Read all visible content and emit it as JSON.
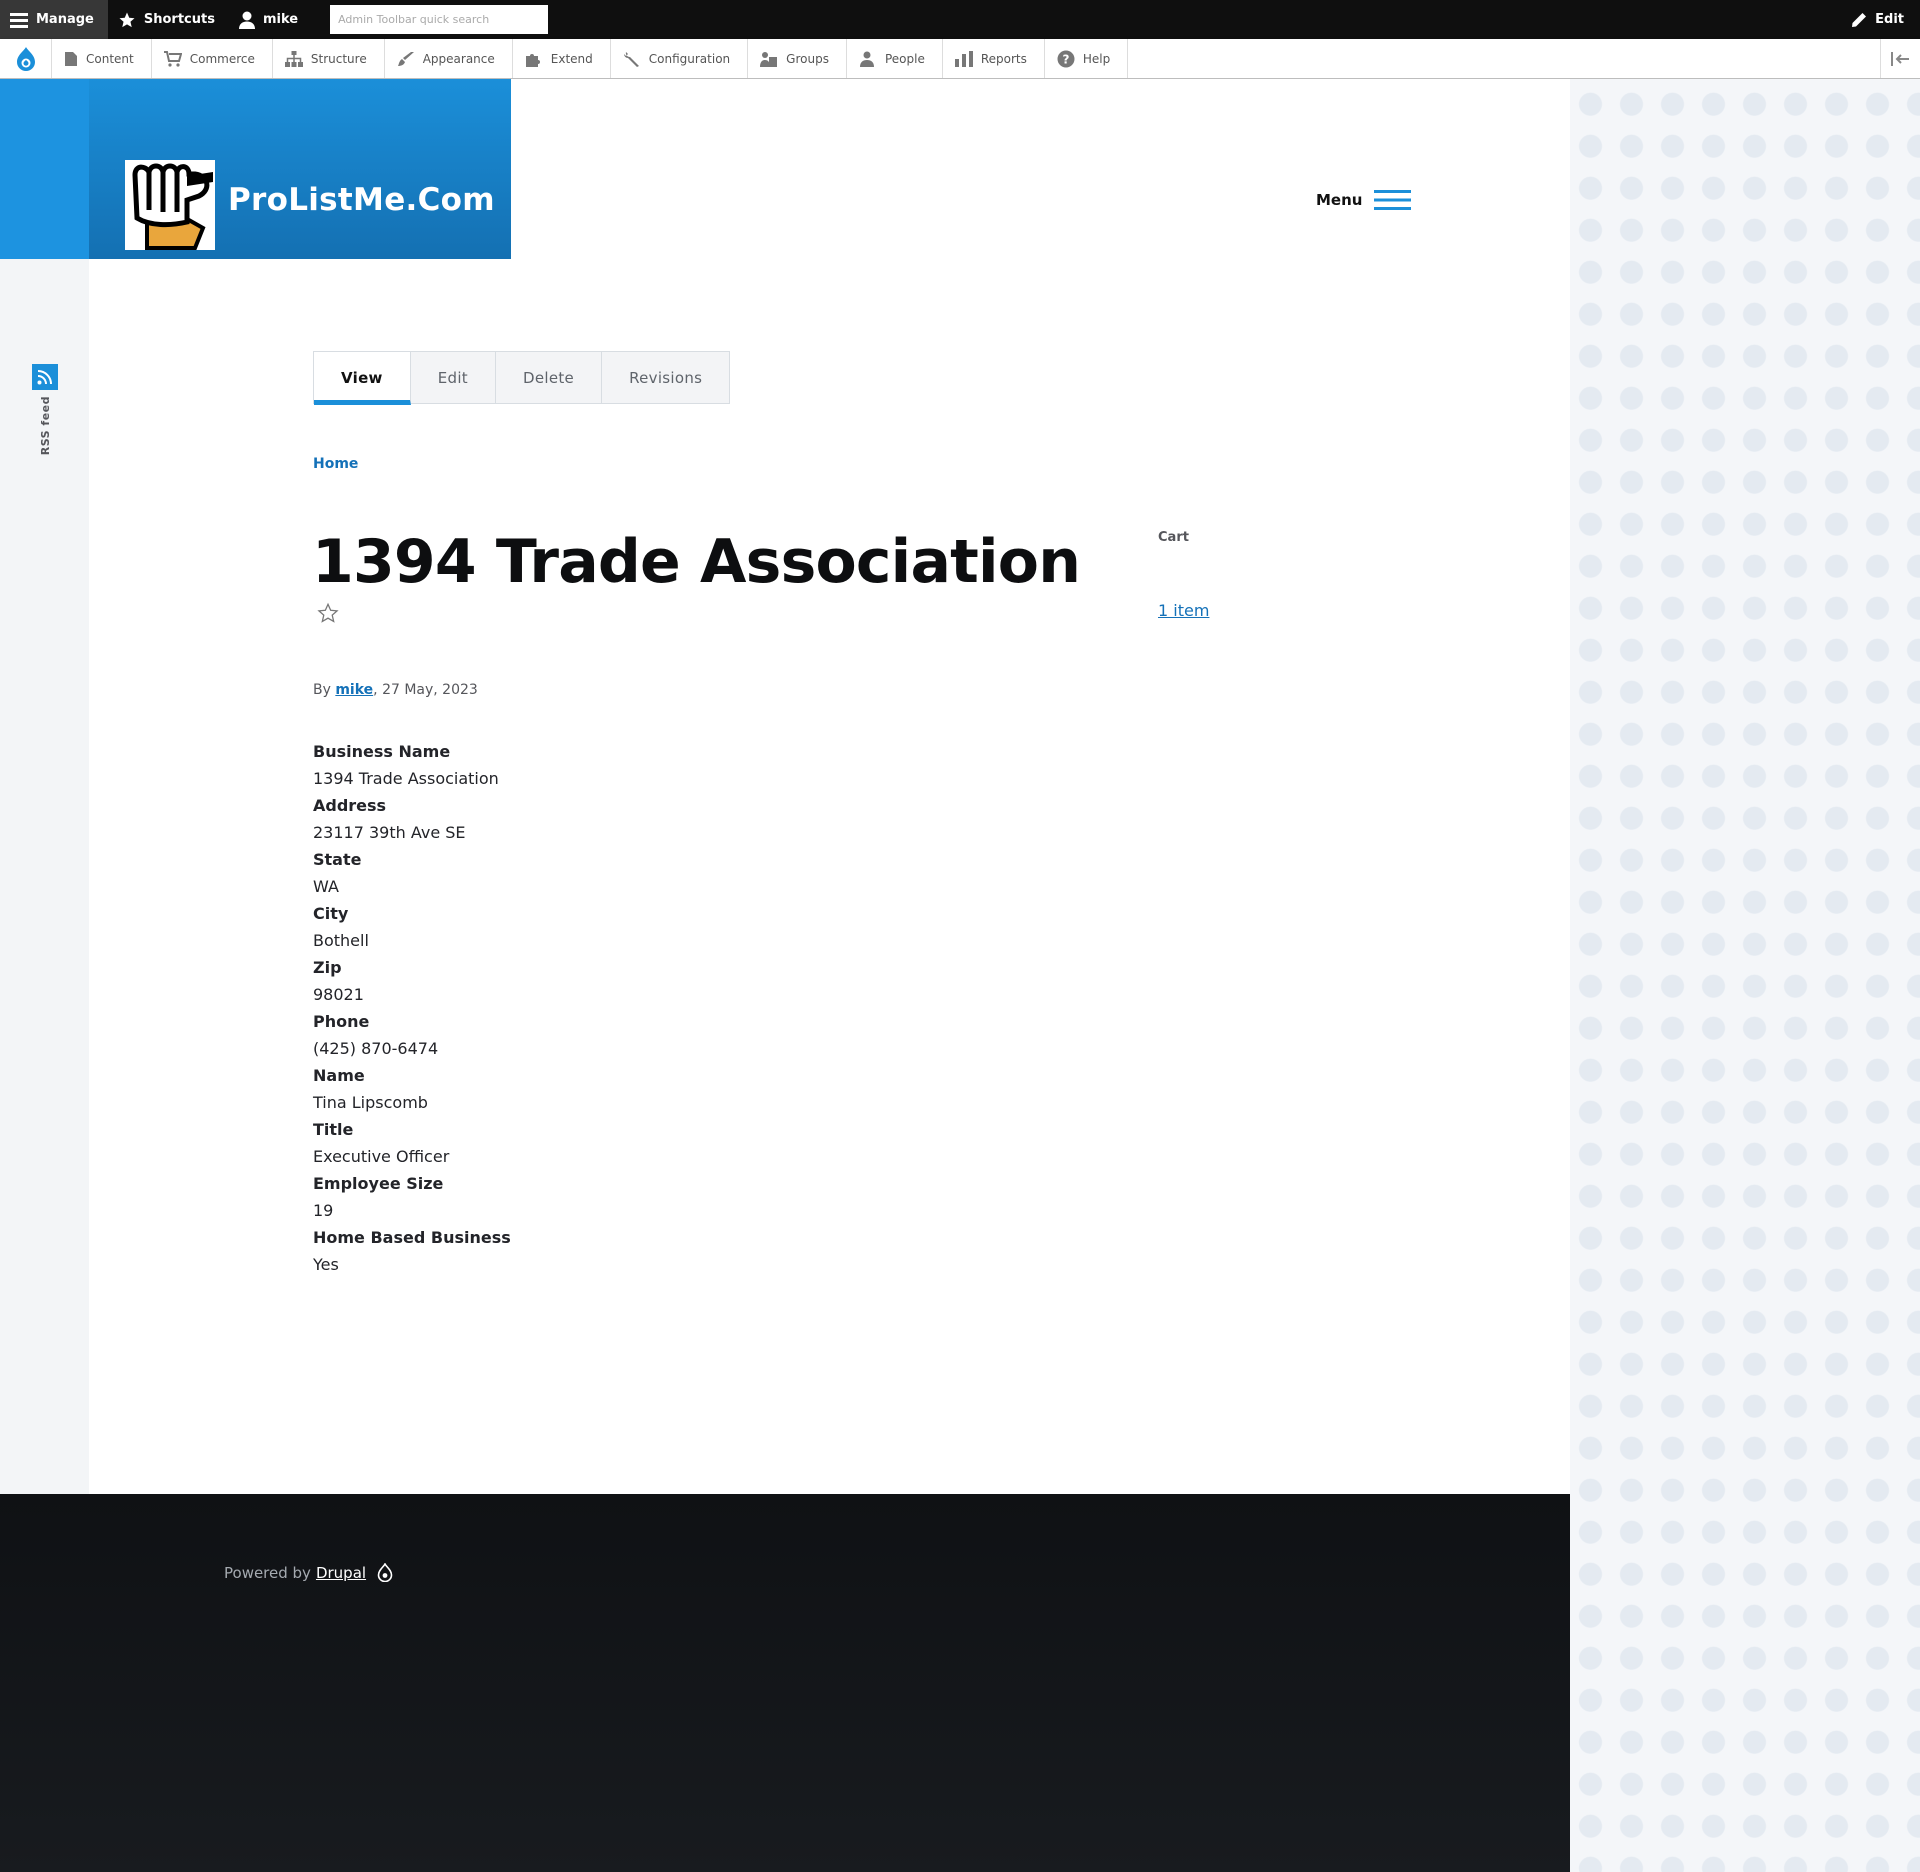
{
  "toolbar": {
    "manage": "Manage",
    "shortcuts": "Shortcuts",
    "user": "mike",
    "search_placeholder": "Admin Toolbar quick search",
    "edit": "Edit"
  },
  "tray": {
    "items": [
      {
        "label": "Content",
        "icon": "file-icon"
      },
      {
        "label": "Commerce",
        "icon": "cart-icon"
      },
      {
        "label": "Structure",
        "icon": "sitemap-icon"
      },
      {
        "label": "Appearance",
        "icon": "brush-icon"
      },
      {
        "label": "Extend",
        "icon": "puzzle-icon"
      },
      {
        "label": "Configuration",
        "icon": "wrench-icon"
      },
      {
        "label": "Groups",
        "icon": "groups-icon"
      },
      {
        "label": "People",
        "icon": "people-icon"
      },
      {
        "label": "Reports",
        "icon": "bar-chart-icon"
      },
      {
        "label": "Help",
        "icon": "help-icon"
      }
    ]
  },
  "site": {
    "name": "ProListMe.Com",
    "menu_label": "Menu",
    "rss_label": "RSS feed"
  },
  "tabs": [
    "View",
    "Edit",
    "Delete",
    "Revisions"
  ],
  "breadcrumb": "Home",
  "node": {
    "title": "1394 Trade Association",
    "by_prefix": "By ",
    "author": "mike",
    "date": ", 27 May, 2023"
  },
  "cart": {
    "label": "Cart",
    "items": "1 item"
  },
  "fields": [
    {
      "label": "Business Name",
      "value": "1394 Trade Association"
    },
    {
      "label": "Address",
      "value": "23117 39th Ave SE"
    },
    {
      "label": "State",
      "value": "WA"
    },
    {
      "label": "City",
      "value": "Bothell"
    },
    {
      "label": "Zip",
      "value": "98021"
    },
    {
      "label": "Phone",
      "value": "(425) 870-6474"
    },
    {
      "label": "Name",
      "value": "Tina Lipscomb"
    },
    {
      "label": "Title",
      "value": "Executive Officer"
    },
    {
      "label": "Employee Size",
      "value": "19"
    },
    {
      "label": "Home Based Business",
      "value": "Yes"
    }
  ],
  "footer": {
    "powered_by": "Powered by",
    "link": "Drupal"
  },
  "colors": {
    "accent": "#1b8fd9",
    "link": "#1471b8",
    "toolbar_bg": "#0f0f0f",
    "footer_bg": "#121418"
  }
}
